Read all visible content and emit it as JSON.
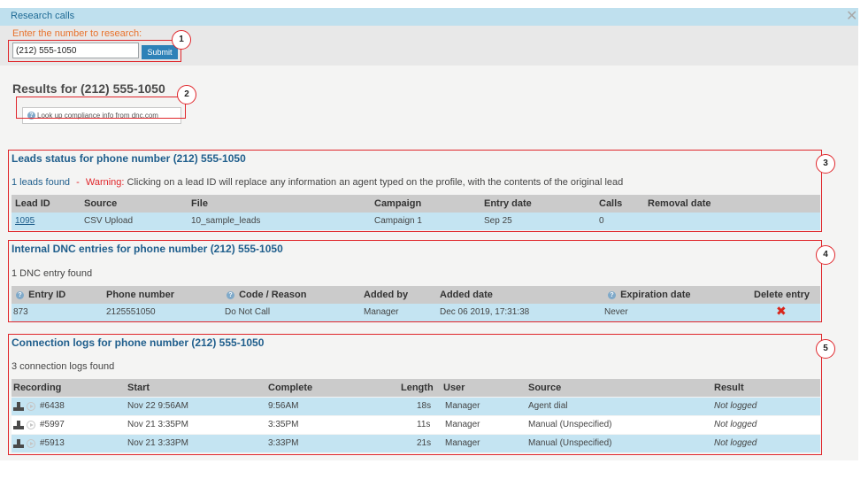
{
  "window": {
    "title": "Research calls",
    "close_glyph": "✕"
  },
  "search": {
    "prompt": "Enter the number to research:",
    "value": "(212) 555-1050",
    "submit_label": "Submit"
  },
  "results_title": "Results for (212) 555-1050",
  "dnc_lookup": {
    "info_glyph": "?",
    "label": "Look up compliance info from dnc.com"
  },
  "callouts": [
    "1",
    "2",
    "3",
    "4",
    "5"
  ],
  "leads": {
    "title": "Leads status for phone number (212) 555-1050",
    "count_text": "1 leads found",
    "separator": "-",
    "warning_label": "Warning:",
    "warning_text": "Clicking on a lead ID will replace any information an agent typed on the profile, with the contents of the original lead",
    "columns": [
      "Lead ID",
      "Source",
      "File",
      "Campaign",
      "Entry date",
      "Calls",
      "Removal date"
    ],
    "rows": [
      {
        "lead_id": "1095",
        "source": "CSV Upload",
        "file": "10_sample_leads",
        "campaign": "Campaign 1",
        "entry_date": "Sep 25",
        "calls": "0",
        "removal_date": ""
      }
    ]
  },
  "dnc": {
    "title": "Internal DNC entries for phone number (212) 555-1050",
    "count_text": "1 DNC entry found",
    "info_glyph": "?",
    "columns": [
      "Entry ID",
      "Phone number",
      "Code / Reason",
      "Added by",
      "Added date",
      "Expiration date",
      "Delete entry"
    ],
    "rows": [
      {
        "entry_id": "873",
        "phone": "2125551050",
        "code": "Do Not Call",
        "added_by": "Manager",
        "added_date": "Dec 06 2019, 17:31:38",
        "expiration": "Never",
        "delete_glyph": "✖"
      }
    ]
  },
  "connections": {
    "title": "Connection logs for phone number (212) 555-1050",
    "count_text": "3 connection logs found",
    "columns": [
      "Recording",
      "Start",
      "Complete",
      "Length",
      "User",
      "Source",
      "Result"
    ],
    "rows": [
      {
        "recording": "#6438",
        "start": "Nov 22 9:56AM",
        "complete": "9:56AM",
        "length": "18s",
        "user": "Manager",
        "source": "Agent dial",
        "result": "Not logged"
      },
      {
        "recording": "#5997",
        "start": "Nov 21 3:35PM",
        "complete": "3:35PM",
        "length": "11s",
        "user": "Manager",
        "source": "Manual (Unspecified)",
        "result": "Not logged"
      },
      {
        "recording": "#5913",
        "start": "Nov 21 3:33PM",
        "complete": "3:33PM",
        "length": "21s",
        "user": "Manager",
        "source": "Manual (Unspecified)",
        "result": "Not logged"
      }
    ]
  },
  "colors": {
    "accent": "#1f5e8c",
    "callout": "#e0262b",
    "prompt": "#e8722c",
    "row_highlight": "#c4e4f2",
    "header_bg": "#cbcbcb"
  }
}
